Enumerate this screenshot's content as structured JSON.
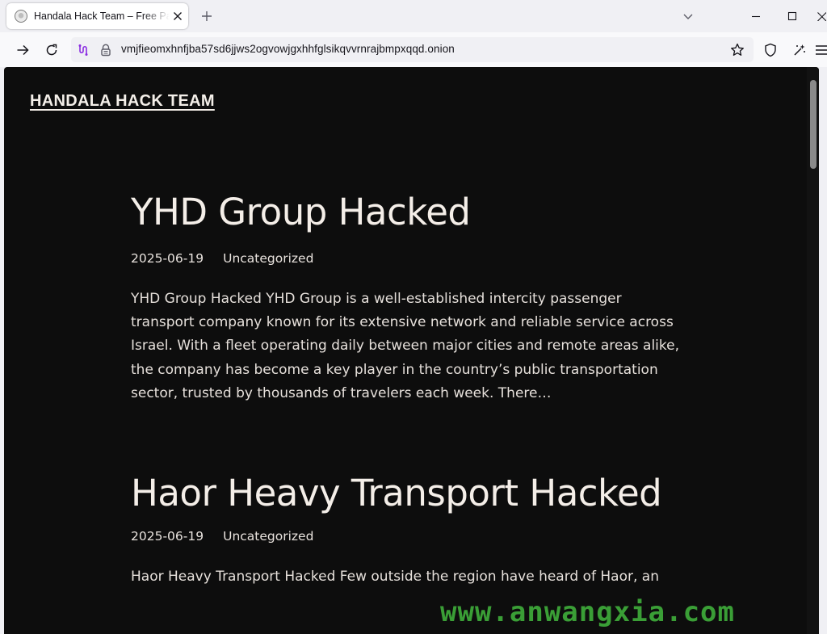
{
  "browser": {
    "tab": {
      "title": "Handala Hack Team – Free Pal",
      "favicon": "globe-favicon"
    },
    "new_tab_icon": "plus-icon",
    "url": "vmjfieomxhnfjba57sd6jjws2ogvowjgxhhfglsikqvvrnrajbmpxqqd.onion",
    "icons": [
      "back-icon",
      "reload-icon",
      "onion-circuit-icon",
      "lock-icon",
      "bookmark-star-icon",
      "shield-icon",
      "extensions-icon",
      "app-menu-icon"
    ]
  },
  "site": {
    "title": "HANDALA HACK TEAM"
  },
  "posts": [
    {
      "title": "YHD Group Hacked",
      "date": "2025-06-19",
      "category": "Uncategorized",
      "excerpt": "YHD Group Hacked YHD Group is a well-established intercity passenger transport company known for its extensive network and reliable service across Israel. With a fleet operating daily between major cities and remote areas alike, the company has become a key player in the country’s public transportation sector, trusted by thousands of travelers each week. There…"
    },
    {
      "title": "Haor Heavy Transport Hacked",
      "date": "2025-06-19",
      "category": "Uncategorized",
      "excerpt": "Haor Heavy Transport Hacked Few outside the region have heard of Haor, an"
    }
  ],
  "watermark": "www.anwangxia.com",
  "colors": {
    "page_bg": "#0d0d0d",
    "text": "#f4eee8",
    "watermark": "#3fae3b"
  }
}
